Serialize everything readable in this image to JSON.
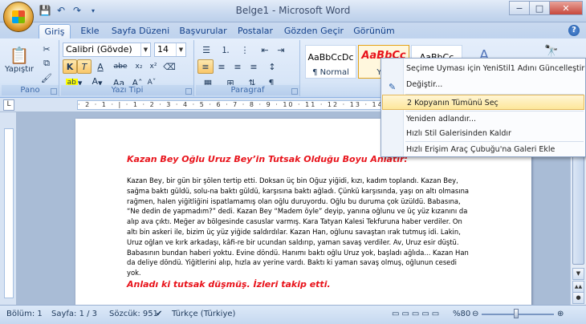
{
  "window": {
    "title": "Belge1 - Microsoft Word",
    "minimize": "−",
    "maximize": "□",
    "close": "✕"
  },
  "qat": {
    "save_icon": "💾",
    "undo_icon": "↶",
    "redo_icon": "↷"
  },
  "tabs": [
    {
      "label": "Giriş",
      "active": true
    },
    {
      "label": "Ekle"
    },
    {
      "label": "Sayfa Düzeni"
    },
    {
      "label": "Başvurular"
    },
    {
      "label": "Postalar"
    },
    {
      "label": "Gözden Geçir"
    },
    {
      "label": "Görünüm"
    }
  ],
  "ribbon": {
    "clipboard": {
      "paste_label": "Yapıştır",
      "group": "Pano"
    },
    "font": {
      "font_name": "Calibri (Gövde)",
      "font_size": "14",
      "group": "Yazı Tipi",
      "bold": "K",
      "italic": "T",
      "underline": "A",
      "strike": "abe",
      "sub": "x₂",
      "sup": "x²",
      "case": "Aa",
      "grow": "Aˆ",
      "shrink": "Aˇ"
    },
    "paragraph": {
      "group": "Paragraf",
      "show_marks": "¶"
    },
    "styles": [
      {
        "sample": "AaBbCcDc",
        "name": "¶ Normal"
      },
      {
        "sample": "AaBbCc",
        "name": "Yen"
      },
      {
        "sample": "AaBbCc",
        "name": ""
      }
    ],
    "find_icon": "🔭"
  },
  "document": {
    "title": "Kazan Bey Oğlu Uruz Bey’in Tutsak Olduğu Boyu Anlatır:",
    "body": "Kazan Bey, bir gün bir şölen tertip etti. Doksan üç bin Oğuz yiğidi, kızı, kadım toplandı. Kazan Bey, sağma baktı güldü, solu-na baktı güldü, karşısına baktı ağladı. Çünkü karşısında, yaşı on altı olmasına rağmen, halen yiğitliğini ispatlamamış olan oğlu duruyordu. Oğlu bu duruma çok üzüldü. Babasına, “Ne dedin de yapmadım?” dedi. Kazan Bey “Madem öyle” deyip, yanına oğlunu ve üç yüz kızanını da alıp ava çıktı. Meğer av bölgesinde casuslar varmış. Kara Tatyan Kalesi Tekfuruna haber verdiler. On altı bin askeri ile, bizim üç yüz yiğide saldırdılar. Kazan Han, oğlunu savaştan ırak tutmuş idi. Lakin, Uruz oğlan ve kırk arkadaşı, kâfi-re bir ucundan saldırıp, yaman savaş verdiler. Av, Uruz esir düştü. Babasının bundan haberi yoktu. Evine döndü. Hanımı baktı oğlu Uruz yok, başladı ağlıda... Kazan Han da deliye döndü. Yiğitlerini alıp, hızla av yerine vardı. Baktı ki yaman savaş olmuş, oğlunun cesedi yok.",
    "foot": "Anladı ki tutsak düşmüş. İzleri takip etti."
  },
  "ruler": {
    "text": "· 2 · 1 · | · 1 · 2 · 3 · 4 · 5 · 6 · 7 · 8 · 9 · 10 · 11 · 12 · 13 · 14 · 15 · 16 ·"
  },
  "status": {
    "section": "Bölüm: 1",
    "page": "Sayfa: 1 / 3",
    "words": "Sözcük: 951",
    "language": "Türkçe (Türkiye)",
    "zoom": "%80"
  },
  "context_menu": {
    "items": [
      "Seçime Uyması için YeniStil1 Adını Güncelleştir",
      "Değiştir...",
      "2 Kopyanın Tümünü Seç",
      "Yeniden adlandır...",
      "Hızlı Stil Galerisinden Kaldır",
      "Hızlı Erişim Araç Çubuğu'na Galeri Ekle"
    ],
    "highlighted_index": 2
  },
  "colors": {
    "accent": "#15428b",
    "doc_red": "#e8131b",
    "highlight": "#fde79a"
  }
}
